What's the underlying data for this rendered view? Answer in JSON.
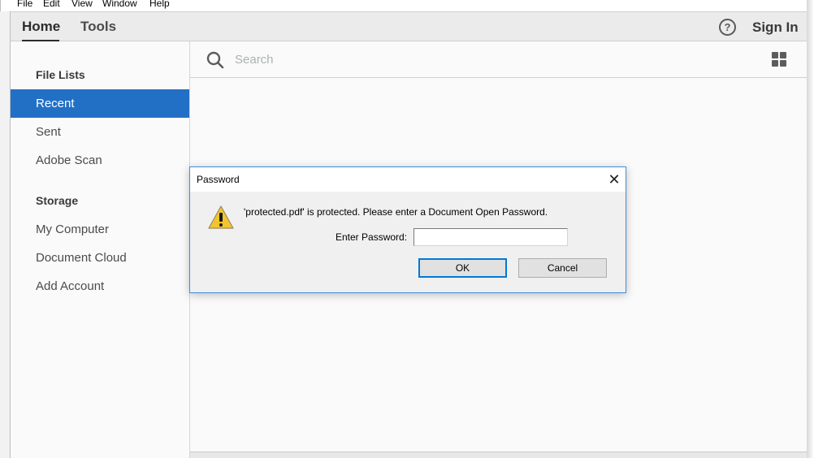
{
  "menubar": {
    "items": [
      "File",
      "Edit",
      "View",
      "Window",
      "Help"
    ]
  },
  "topnav": {
    "tabs": [
      {
        "label": "Home",
        "active": true
      },
      {
        "label": "Tools",
        "active": false
      }
    ],
    "help_icon": "?",
    "sign_in_label": "Sign In"
  },
  "sidebar": {
    "sections": [
      {
        "heading": "File Lists",
        "items": [
          {
            "label": "Recent",
            "active": true
          },
          {
            "label": "Sent",
            "active": false
          },
          {
            "label": "Adobe Scan",
            "active": false
          }
        ]
      },
      {
        "heading": "Storage",
        "items": [
          {
            "label": "My Computer",
            "active": false
          },
          {
            "label": "Document Cloud",
            "active": false
          },
          {
            "label": "Add Account",
            "active": false
          }
        ]
      }
    ]
  },
  "search": {
    "placeholder": "Search",
    "value": "",
    "icon": "search-icon",
    "view_toggle_icon": "grid-view-icon"
  },
  "dialog": {
    "title": "Password",
    "close_glyph": "✕",
    "message": "'protected.pdf' is protected. Please enter a Document Open Password.",
    "field_label": "Enter Password:",
    "field_value": "",
    "ok_label": "OK",
    "cancel_label": "Cancel",
    "icon": "warning-icon"
  },
  "colors": {
    "accent": "#2270c6",
    "dialog_border": "#3f8fd8",
    "default_button_border": "#0078d7"
  }
}
